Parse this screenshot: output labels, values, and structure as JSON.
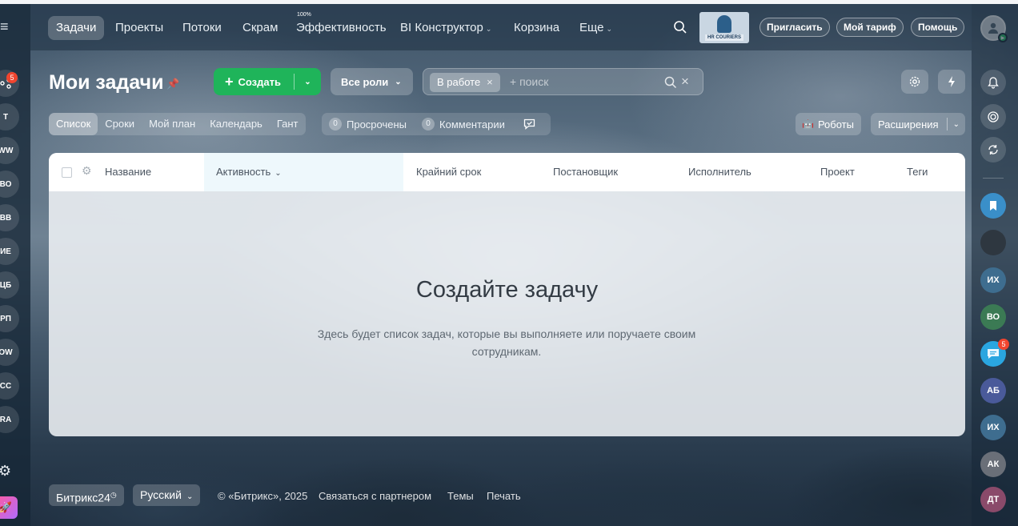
{
  "nav": {
    "tabs": [
      {
        "label": "Задачи"
      },
      {
        "label": "Проекты"
      },
      {
        "label": "Потоки"
      },
      {
        "label": "Скрам"
      },
      {
        "label": "Эффективность"
      },
      {
        "label": "BI Конструктор"
      },
      {
        "label": "Корзина"
      },
      {
        "label": "Еще"
      }
    ],
    "efficiency_badge": "100%",
    "logo_text": "HR COURIERS",
    "invite_label": "Пригласить",
    "tariff_label": "Мой тариф",
    "help_label": "Помощь"
  },
  "left_sidebar": {
    "items": [
      "Т",
      "WW",
      "ВО",
      "ВВ",
      "ИЕ",
      "ЦБ",
      "РП",
      "OW",
      "СС",
      "RA"
    ],
    "badge": "5"
  },
  "right_sidebar": {
    "avatars": [
      {
        "initials": "ИХ",
        "color": "#3e6d8f"
      },
      {
        "initials": "ВО",
        "color": "#3b7a54"
      },
      {
        "initials": "АБ",
        "color": "#4a5a9a"
      },
      {
        "initials": "ИХ",
        "color": "#3e6d8f"
      },
      {
        "initials": "АК",
        "color": "#6a6f78"
      },
      {
        "initials": "ДТ",
        "color": "#8a4a6a"
      }
    ],
    "chat_badge": "5"
  },
  "header": {
    "title": "Мои задачи",
    "create_label": "Создать",
    "roles_label": "Все роли",
    "filter_chip": "В работе",
    "search_placeholder": "+ поиск"
  },
  "subheader": {
    "view_tabs": [
      "Список",
      "Сроки",
      "Мой план",
      "Календарь",
      "Гант"
    ],
    "overdue_count": "0",
    "overdue_label": "Просрочены",
    "comments_count": "0",
    "comments_label": "Комментарии",
    "robots_label": "Роботы",
    "extensions_label": "Расширения"
  },
  "table": {
    "columns": [
      "Название",
      "Активность",
      "Крайний срок",
      "Постановщик",
      "Исполнитель",
      "Проект",
      "Теги"
    ],
    "empty_title": "Создайте задачу",
    "empty_description": "Здесь будет список задач, которые вы выполняете или поручаете своим сотрудникам."
  },
  "footer": {
    "brand": "Битрикс24",
    "language": "Русский",
    "copyright": "© «Битрикс», 2025",
    "links": [
      "Связаться с партнером",
      "Темы",
      "Печать"
    ]
  },
  "colors": {
    "create_green": "#1fb45a",
    "badge_red": "#f0452f",
    "online_green": "#2fc26e"
  }
}
